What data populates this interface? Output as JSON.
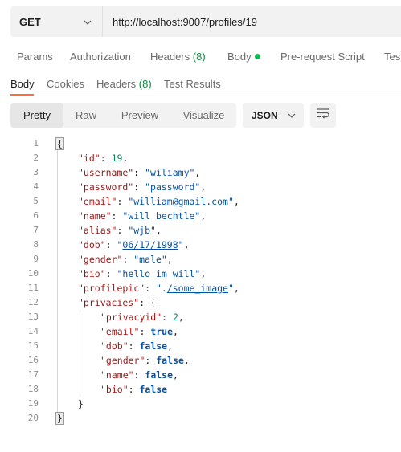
{
  "request": {
    "method": "GET",
    "url": "http://localhost:9007/profiles/19"
  },
  "request_tabs": [
    {
      "label": "Params",
      "count": "",
      "dot": false
    },
    {
      "label": "Authorization",
      "count": "",
      "dot": false
    },
    {
      "label": "Headers",
      "count": "(8)",
      "dot": false
    },
    {
      "label": "Body",
      "count": "",
      "dot": true
    },
    {
      "label": "Pre-request Script",
      "count": "",
      "dot": false
    },
    {
      "label": "Test",
      "count": "",
      "dot": false
    }
  ],
  "response_tabs": [
    {
      "label": "Body",
      "count": ""
    },
    {
      "label": "Cookies",
      "count": ""
    },
    {
      "label": "Headers",
      "count": "(8)"
    },
    {
      "label": "Test Results",
      "count": ""
    }
  ],
  "view_modes": [
    "Pretty",
    "Raw",
    "Preview",
    "Visualize"
  ],
  "active_view": "Pretty",
  "format": "JSON",
  "response_lines": [
    {
      "indent": 0,
      "tokens": [
        [
          "fold",
          "{"
        ]
      ]
    },
    {
      "indent": 1,
      "tokens": [
        [
          "k",
          "\"id\""
        ],
        [
          "p",
          ": "
        ],
        [
          "n",
          "19"
        ],
        [
          "p",
          ","
        ]
      ]
    },
    {
      "indent": 1,
      "tokens": [
        [
          "k",
          "\"username\""
        ],
        [
          "p",
          ": "
        ],
        [
          "s",
          "\"wiliamy\""
        ],
        [
          "p",
          ","
        ]
      ]
    },
    {
      "indent": 1,
      "tokens": [
        [
          "k",
          "\"password\""
        ],
        [
          "p",
          ": "
        ],
        [
          "s",
          "\"password\""
        ],
        [
          "p",
          ","
        ]
      ]
    },
    {
      "indent": 1,
      "tokens": [
        [
          "k",
          "\"email\""
        ],
        [
          "p",
          ": "
        ],
        [
          "s",
          "\"william@gmail.com\""
        ],
        [
          "p",
          ","
        ]
      ]
    },
    {
      "indent": 1,
      "tokens": [
        [
          "k",
          "\"name\""
        ],
        [
          "p",
          ": "
        ],
        [
          "s",
          "\"will bechtle\""
        ],
        [
          "p",
          ","
        ]
      ]
    },
    {
      "indent": 1,
      "tokens": [
        [
          "k",
          "\"alias\""
        ],
        [
          "p",
          ": "
        ],
        [
          "s",
          "\"wjb\""
        ],
        [
          "p",
          ","
        ]
      ]
    },
    {
      "indent": 1,
      "tokens": [
        [
          "k",
          "\"dob\""
        ],
        [
          "p",
          ": "
        ],
        [
          "s",
          "\""
        ],
        [
          "link",
          "06/17/1998"
        ],
        [
          "s",
          "\""
        ],
        [
          "p",
          ","
        ]
      ]
    },
    {
      "indent": 1,
      "tokens": [
        [
          "k",
          "\"gender\""
        ],
        [
          "p",
          ": "
        ],
        [
          "s",
          "\"male\""
        ],
        [
          "p",
          ","
        ]
      ]
    },
    {
      "indent": 1,
      "tokens": [
        [
          "k",
          "\"bio\""
        ],
        [
          "p",
          ": "
        ],
        [
          "s",
          "\"hello im will\""
        ],
        [
          "p",
          ","
        ]
      ]
    },
    {
      "indent": 1,
      "tokens": [
        [
          "k",
          "\"profilepic\""
        ],
        [
          "p",
          ": "
        ],
        [
          "s",
          "\"."
        ],
        [
          "link",
          "/some_image"
        ],
        [
          "s",
          "\""
        ],
        [
          "p",
          ","
        ]
      ]
    },
    {
      "indent": 1,
      "tokens": [
        [
          "k",
          "\"privacies\""
        ],
        [
          "p",
          ": {"
        ]
      ]
    },
    {
      "indent": 2,
      "tokens": [
        [
          "k",
          "\"privacyid\""
        ],
        [
          "p",
          ": "
        ],
        [
          "n",
          "2"
        ],
        [
          "p",
          ","
        ]
      ]
    },
    {
      "indent": 2,
      "tokens": [
        [
          "k",
          "\"email\""
        ],
        [
          "p",
          ": "
        ],
        [
          "b",
          "true"
        ],
        [
          "p",
          ","
        ]
      ]
    },
    {
      "indent": 2,
      "tokens": [
        [
          "k",
          "\"dob\""
        ],
        [
          "p",
          ": "
        ],
        [
          "b",
          "false"
        ],
        [
          "p",
          ","
        ]
      ]
    },
    {
      "indent": 2,
      "tokens": [
        [
          "k",
          "\"gender\""
        ],
        [
          "p",
          ": "
        ],
        [
          "b",
          "false"
        ],
        [
          "p",
          ","
        ]
      ]
    },
    {
      "indent": 2,
      "tokens": [
        [
          "k",
          "\"name\""
        ],
        [
          "p",
          ": "
        ],
        [
          "b",
          "false"
        ],
        [
          "p",
          ","
        ]
      ]
    },
    {
      "indent": 2,
      "tokens": [
        [
          "k",
          "\"bio\""
        ],
        [
          "p",
          ": "
        ],
        [
          "b",
          "false"
        ]
      ]
    },
    {
      "indent": 1,
      "tokens": [
        [
          "p",
          "}"
        ]
      ]
    },
    {
      "indent": 0,
      "tokens": [
        [
          "fold",
          "}"
        ]
      ]
    }
  ],
  "colors": {
    "accent": "#ff6c37",
    "count_green": "#0c8a3e",
    "body_dot": "#0cbb52",
    "json_key": "#a31515",
    "json_string": "#0451a5",
    "json_number": "#098658"
  }
}
